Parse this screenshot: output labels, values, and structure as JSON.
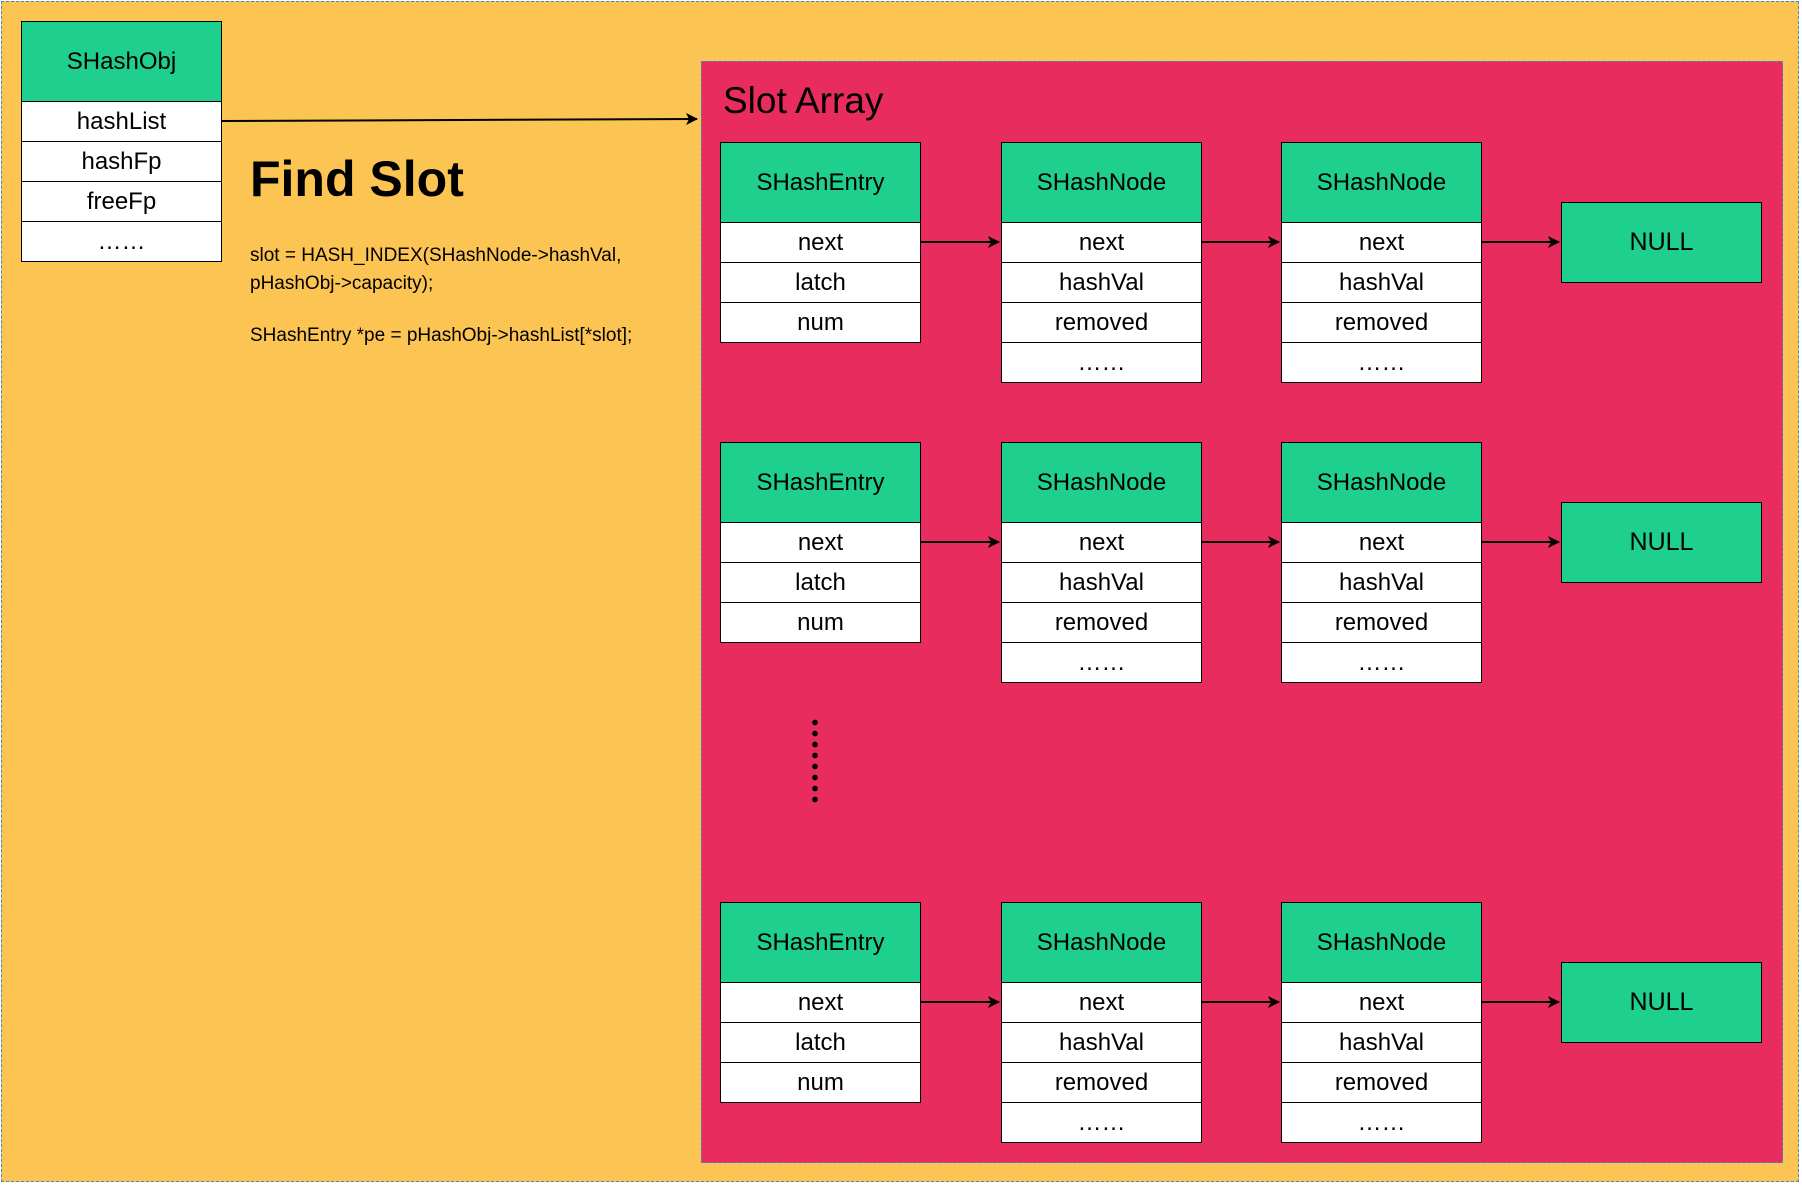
{
  "shashobj": {
    "header": "SHashObj",
    "fields": [
      "hashList",
      "hashFp",
      "freeFp",
      "……"
    ]
  },
  "find_slot": {
    "title": "Find Slot",
    "code_line1": "slot = HASH_INDEX(SHashNode->hashVal,",
    "code_line2": "pHashObj->capacity);",
    "code_line3": "SHashEntry *pe = pHashObj->hashList[*slot];"
  },
  "slot_array": {
    "title": "Slot Array",
    "rows": [
      {
        "entry": {
          "header": "SHashEntry",
          "fields": [
            "next",
            "latch",
            "num"
          ]
        },
        "nodes": [
          {
            "header": "SHashNode",
            "fields": [
              "next",
              "hashVal",
              "removed",
              "……"
            ]
          },
          {
            "header": "SHashNode",
            "fields": [
              "next",
              "hashVal",
              "removed",
              "……"
            ]
          }
        ],
        "terminal": "NULL"
      },
      {
        "entry": {
          "header": "SHashEntry",
          "fields": [
            "next",
            "latch",
            "num"
          ]
        },
        "nodes": [
          {
            "header": "SHashNode",
            "fields": [
              "next",
              "hashVal",
              "removed",
              "……"
            ]
          },
          {
            "header": "SHashNode",
            "fields": [
              "next",
              "hashVal",
              "removed",
              "……"
            ]
          }
        ],
        "terminal": "NULL"
      },
      {
        "entry": {
          "header": "SHashEntry",
          "fields": [
            "next",
            "latch",
            "num"
          ]
        },
        "nodes": [
          {
            "header": "SHashNode",
            "fields": [
              "next",
              "hashVal",
              "removed",
              "……"
            ]
          },
          {
            "header": "SHashNode",
            "fields": [
              "next",
              "hashVal",
              "removed",
              "……"
            ]
          }
        ],
        "terminal": "NULL"
      }
    ]
  },
  "colors": {
    "background": "#FCC452",
    "slot_array": "#E82C5E",
    "struct_header": "#1ECF8E",
    "field": "#FFFFFF",
    "border": "#000000",
    "dashed_outline": "#3C8BD9"
  }
}
